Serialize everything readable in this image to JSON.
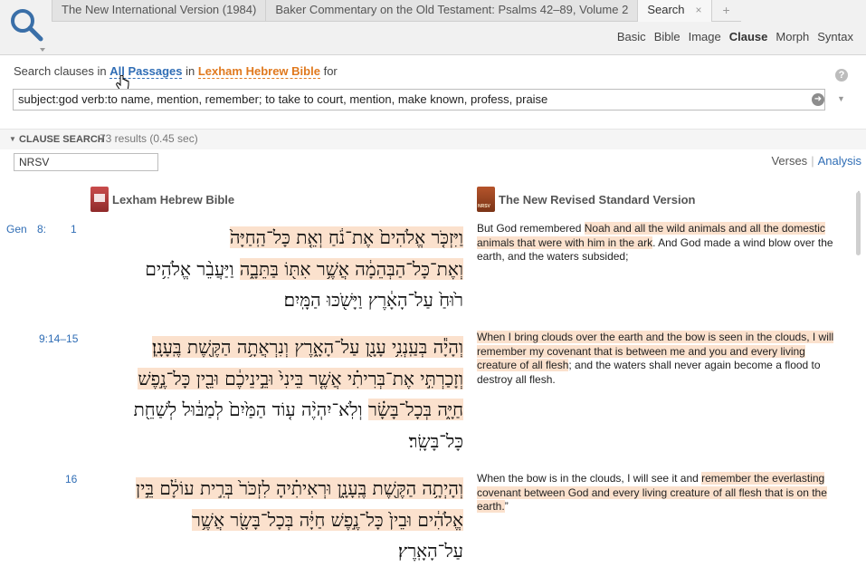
{
  "tabs": [
    {
      "label": "The New International Version (1984)",
      "active": false
    },
    {
      "label": "Baker Commentary on the Old Testament: Psalms 42–89, Volume 2",
      "active": false
    },
    {
      "label": "Search",
      "active": true
    }
  ],
  "tab_add": "+",
  "tab_close": "×",
  "modes": [
    "Basic",
    "Bible",
    "Image",
    "Clause",
    "Morph",
    "Syntax"
  ],
  "active_mode": "Clause",
  "query": {
    "prefix": "Search clauses in",
    "scope": "All Passages",
    "in_text": "in",
    "resource": "Lexham Hebrew Bible",
    "suffix": "for",
    "value": "subject:god verb:to name, mention, remember; to take to court, mention, make known, profess, praise",
    "help": "?",
    "go": "➜",
    "dropdown": "▼"
  },
  "results": {
    "section_label": "CLAUSE SEARCH",
    "count": "73 results (0.45 sec)",
    "filter_value": "NRSV",
    "view_verses": "Verses",
    "view_analysis": "Analysis"
  },
  "columns": {
    "left_title": "Lexham Hebrew Bible",
    "right_title": "The New Revised Standard Version"
  },
  "rows": [
    {
      "book": "Gen",
      "chapter": "8:",
      "verse": "1",
      "hebrew": [
        {
          "text": "וַיִּזְכֹּ֤ר אֱלֹהִים֙ אֶת־נֹ֔חַ וְאֵ֤ת כָּל־הַֽחַיָּה֙",
          "hl": true
        },
        {
          "text": "וְאֶת־כָּל־הַבְּהֵמָ֔ה אֲשֶׁ֥ר אִתּ֖וֹ בַּתֵּבָ֑ה",
          "hl": true
        },
        {
          "text": " וַיַּעֲבֵ֨ר אֱלֹהִ֥ים",
          "hl": false
        },
        {
          "text": "ר֙וּחַ֙ עַל־הָאָ֔רֶץ וַיָּשֹׁ֖כּוּ הַמָּֽיִם׃",
          "hl": false
        }
      ],
      "english": [
        {
          "text": "But God remembered ",
          "hl": false
        },
        {
          "text": "Noah and ",
          "hl": true
        },
        {
          "text": "all the wild animals and ",
          "hl": true
        },
        {
          "text": "all the domestic animals that were with him in the ark",
          "hl": true
        },
        {
          "text": ". And God made a wind blow over the earth, and the waters subsided;",
          "hl": false
        }
      ]
    },
    {
      "book": "",
      "chapter": "",
      "verse": "9:14–15",
      "hebrew": [
        {
          "text": "וְהָיָ֕ה בְּעַֽנְנִ֥י עָנָ֖ן עַל־הָאָ֑רֶץ וְנִרְאֲתָ֥ה הַקֶּ֖שֶׁת בֶּֽעָנָֽן׃",
          "hl": true
        },
        {
          "text": "וְזָכַרְתִּ֣י אֶת־בְּרִיתִ֗י אֲשֶׁ֤ר בֵּינִי֙ וּבֵ֣ינֵיכֶ֔ם וּבֵ֖ין כָּל־נֶ֣פֶשׁ",
          "hl": true
        },
        {
          "text": "חַיָּ֑ה בְּכָל־בָּשָׂ֗ר",
          "hl": true
        },
        {
          "text": " וְלֹֽא־יִהְיֶ֨ה ע֤וֹד הַמַּ֙יִם֙ לְמַבּ֔וּל לְשַׁחֵ֖ת",
          "hl": false
        },
        {
          "text": "כָּל־בָּשָֽׂר׃",
          "hl": false
        }
      ],
      "english": [
        {
          "text": "When I bring clouds over the earth and the bow is seen in the clouds, I will remember my covenant that is between me and you and every living creature of all flesh",
          "hl": true
        },
        {
          "text": "; and the waters shall never again become a flood to destroy all flesh.",
          "hl": false
        }
      ]
    },
    {
      "book": "",
      "chapter": "",
      "verse": "16",
      "hebrew": [
        {
          "text": "וְהָיְתָ֥ה הַקֶּ֖שֶׁת בֶּֽעָנָ֑ן וּרְאִיתִ֗יהָ לִזְכֹּר֙ בְּרִ֣ית עוֹלָ֔ם בֵּ֣ין",
          "hl": true
        },
        {
          "text": "אֱלֹהִ֔ים וּבֵין֙ כָּל־נֶ֣פֶשׁ חַיָּ֔ה בְּכָל־בָּשָׂ֖ר אֲשֶׁ֥ר",
          "hl": true
        },
        {
          "text": "עַל־הָאָֽרֶץ׃",
          "hl": false
        }
      ],
      "english": [
        {
          "text": "When the bow is in the clouds, I will see it and ",
          "hl": false
        },
        {
          "text": "remember the everlasting covenant between God and every living creature of all flesh that is on the earth.",
          "hl": true
        },
        {
          "text": "”",
          "hl": false
        }
      ]
    }
  ],
  "colors": {
    "accent_blue": "#2f6db5",
    "accent_orange": "#e0791e",
    "highlight": "#fbe1cd"
  }
}
